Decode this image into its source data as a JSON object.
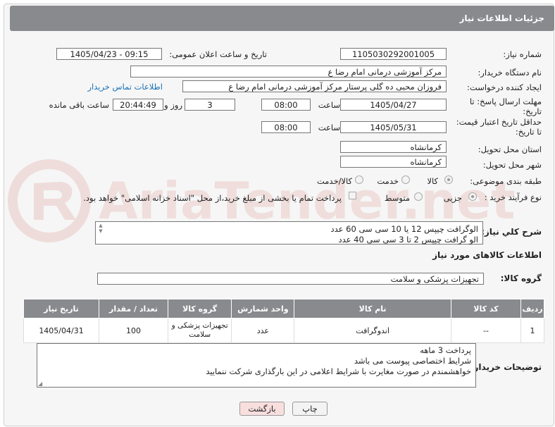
{
  "header": {
    "title": "جزئیات اطلاعات نیاز"
  },
  "watermark": {
    "text": "AriaTender.net"
  },
  "need_number": {
    "label": "شماره نیاز:",
    "value": "1105030292001005"
  },
  "announce_datetime": {
    "label": "تاریخ و ساعت اعلان عمومی:",
    "value": "1405/04/23 - 09:15"
  },
  "buyer_org": {
    "label": "نام دستگاه خریدار:",
    "value": "مرکز آموزشی  درمانی امام رضا  ع"
  },
  "requester": {
    "label": "ایجاد کننده درخواست:",
    "value": "فروزان محبی ده گلی پرستار مرکز آموزشی  درمانی امام رضا  ع",
    "contact_link": "اطلاعات تماس خریدار"
  },
  "reply_deadline": {
    "label_line1": "مهلت ارسال پاسخ: تا",
    "label_line2": "تاریخ:",
    "date": "1405/04/27",
    "time_label": "ساعت",
    "time": "08:00",
    "days": "3",
    "days_label": "روز و",
    "remaining": "20:44:49",
    "remaining_label": "ساعت باقی مانده"
  },
  "price_validity": {
    "label_line1": "حداقل تاریخ اعتبار قیمت:",
    "label_line2": "تا تاریخ:",
    "date": "1405/05/31",
    "time_label": "ساعت",
    "time": "08:00"
  },
  "delivery_province": {
    "label": "استان محل تحویل:",
    "value": "کرمانشاه"
  },
  "delivery_city": {
    "label": "شهر محل تحویل:",
    "value": "کرمانشاه"
  },
  "category": {
    "label": "طبقه بندی موضوعی:",
    "options": [
      "کالا",
      "خدمت",
      "کالا/خدمت"
    ],
    "selected": "کالا"
  },
  "purchase_type": {
    "label": "نوع فرآیند خرید :",
    "options": [
      "جزیی",
      "متوسط"
    ],
    "selected": "جزیی",
    "payment_note": "پرداخت تمام یا بخشی از مبلغ خرید،از محل \"اسناد خزانه اسلامی\" خواهد بود."
  },
  "general_desc": {
    "label": "شرح كلي نياز:",
    "line1": "الوگرافت چیپس  12 یا 10 سی سی   60 عدد",
    "line2": "الو گرافت چیپس  2 تا 3 سی سی    40 عدد"
  },
  "goods_info": {
    "title": "اطلاعات کالاهای مورد نیاز"
  },
  "goods_group": {
    "label": "گروه کالا:",
    "value": "تجهیزات پزشکی و سلامت"
  },
  "table": {
    "headers": [
      "ردیف",
      "کد کالا",
      "نام کالا",
      "واحد شمارش",
      "گروه کالا",
      "تعداد / مقدار",
      "تاریخ نیاز"
    ],
    "rows": [
      [
        "1",
        "--",
        "اندوگرافت",
        "عدد",
        "تجهیزات پزشکی و سلامت",
        "100",
        "1405/04/31"
      ]
    ]
  },
  "buyer_notes": {
    "label": "توضیحات خریدار:",
    "line1": "پرداخت 3 ماهه",
    "line2": "شرایط اختصاصی پیوست می باشد",
    "line3": "خواهشمندم  در صورت مغایرت با شرایط اعلامی در این بارگذاری شرکت ننمایید"
  },
  "buttons": {
    "print": "چاپ",
    "back": "بازگشت"
  },
  "colors": {
    "header_bg": "#888a8d",
    "link": "#1a6fb3",
    "back_btn_bg": "#f9dede"
  }
}
